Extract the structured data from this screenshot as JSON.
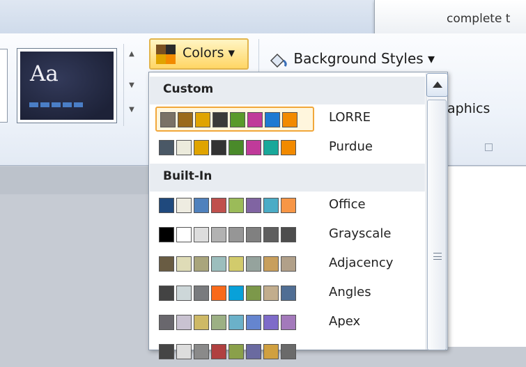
{
  "tooltip": {
    "text": "complete t"
  },
  "ribbon": {
    "theme_preview_text": "Aa",
    "colors_button_label": "Colors ▾",
    "background_styles_label": "Background Styles ▾",
    "graphics_label": "aphics"
  },
  "dropdown": {
    "custom_header": "Custom",
    "builtin_header": "Built-In",
    "custom": [
      {
        "label": "LORRE",
        "selected": true,
        "colors": [
          "#7a7266",
          "#9a6a1a",
          "#e0a400",
          "#3a3a3a",
          "#5a9a2a",
          "#c03a9a",
          "#1e7ad2",
          "#f28a00"
        ]
      },
      {
        "label": "Purdue",
        "selected": false,
        "colors": [
          "#4a5866",
          "#ecebdc",
          "#e0a400",
          "#333333",
          "#4a8a2a",
          "#c03a9a",
          "#19a89a",
          "#f28a00"
        ]
      }
    ],
    "builtin": [
      {
        "label": "Office",
        "colors": [
          "#1f497d",
          "#eeece1",
          "#4f81bd",
          "#c0504d",
          "#9bbb59",
          "#8064a2",
          "#4bacc6",
          "#f79646"
        ]
      },
      {
        "label": "Grayscale",
        "colors": [
          "#000000",
          "#ffffff",
          "#dddddd",
          "#b2b2b2",
          "#969696",
          "#808080",
          "#5f5f5f",
          "#4d4d4d"
        ]
      },
      {
        "label": "Adjacency",
        "colors": [
          "#695c43",
          "#dfdcb7",
          "#a9a57c",
          "#9cbebd",
          "#d2cb6c",
          "#95a39d",
          "#c89f5d",
          "#b1a089"
        ]
      },
      {
        "label": "Angles",
        "colors": [
          "#434343",
          "#cdd7d9",
          "#797b7e",
          "#f96a1b",
          "#08a1d9",
          "#7c984a",
          "#c2ad8d",
          "#506e94"
        ]
      },
      {
        "label": "Apex",
        "colors": [
          "#69676d",
          "#c9c2d1",
          "#ceb966",
          "#9cb084",
          "#6bb1c9",
          "#6585cf",
          "#7e6bc9",
          "#a379bb"
        ]
      },
      {
        "label": "",
        "colors": [
          "#454545",
          "#dddddd",
          "#8a8a8a",
          "#b04040",
          "#8aa04a",
          "#6a6aa0",
          "#d0a040",
          "#6a6a6a"
        ]
      }
    ]
  },
  "colors": {
    "accent_orange": "#f1a73a",
    "ribbon_bg": "#eef3fa"
  }
}
